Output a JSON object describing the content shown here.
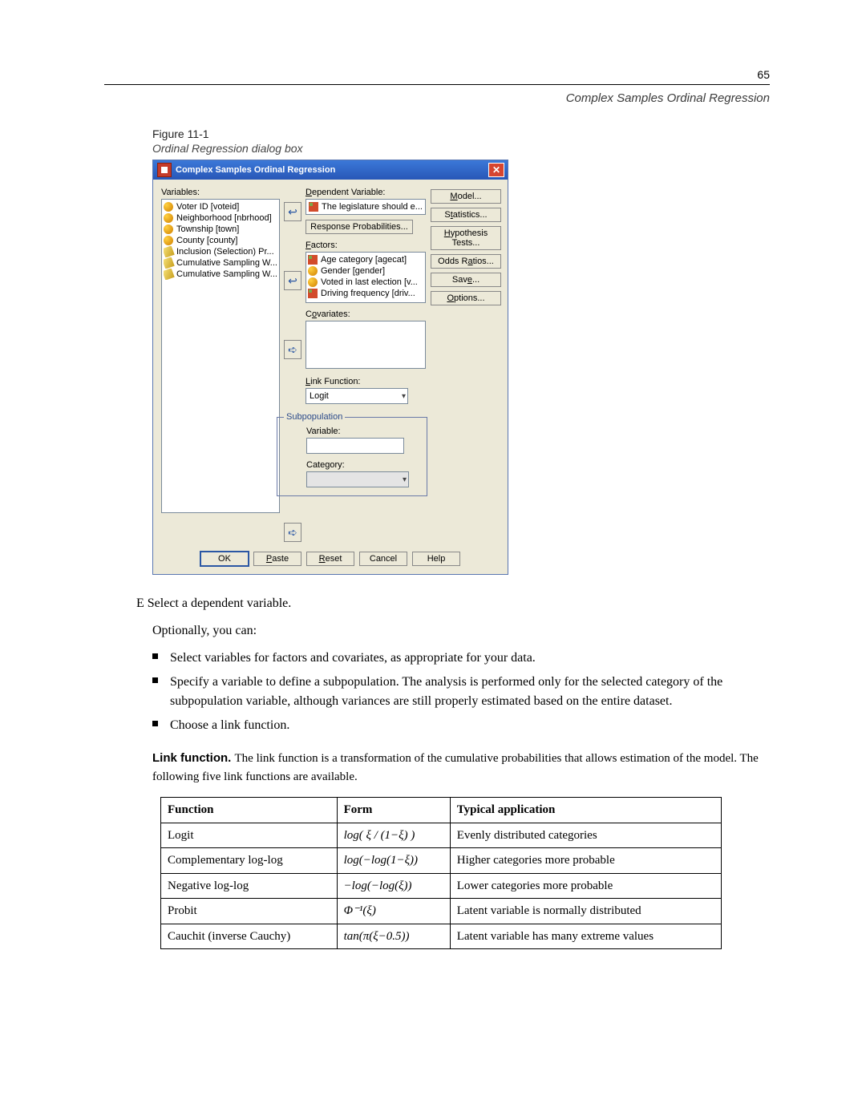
{
  "page": {
    "number": "65",
    "section": "Complex Samples Ordinal Regression"
  },
  "figure": {
    "label": "Figure 11-1",
    "caption": "Ordinal Regression dialog box"
  },
  "dialog": {
    "title": "Complex Samples Ordinal Regression",
    "variables_label": "Variables:",
    "variables": [
      {
        "icon": "scale",
        "text": "Voter ID [voteid]"
      },
      {
        "icon": "scale",
        "text": "Neighborhood [nbrhood]"
      },
      {
        "icon": "scale",
        "text": "Township [town]"
      },
      {
        "icon": "scale",
        "text": "County [county]"
      },
      {
        "icon": "ruler",
        "text": "Inclusion (Selection) Pr..."
      },
      {
        "icon": "ruler",
        "text": "Cumulative Sampling W..."
      },
      {
        "icon": "ruler",
        "text": "Cumulative Sampling W..."
      }
    ],
    "dependent_label": "Dependent Variable:",
    "dependent_value": "The legislature should e...",
    "response_btn": "Response Probabilities...",
    "factors_label": "Factors:",
    "factors": [
      {
        "icon": "ordinal",
        "text": "Age category [agecat]"
      },
      {
        "icon": "scale",
        "text": "Gender [gender]"
      },
      {
        "icon": "scale",
        "text": "Voted in last election [v..."
      },
      {
        "icon": "ordinal",
        "text": "Driving frequency [driv..."
      }
    ],
    "covariates_label": "Covariates:",
    "link_label": "Link Function:",
    "link_value": "Logit",
    "subpop_legend": "Subpopulation",
    "subpop_var_label": "Variable:",
    "subpop_cat_label": "Category:",
    "right_buttons": {
      "model": "Model...",
      "statistics": "Statistics...",
      "hyp": "Hypothesis Tests...",
      "odds": "Odds Ratios...",
      "save": "Save...",
      "options": "Options..."
    },
    "buttons": {
      "ok": "OK",
      "paste": "Paste",
      "reset": "Reset",
      "cancel": "Cancel",
      "help": "Help"
    }
  },
  "content": {
    "step": "E   Select a dependent variable.",
    "optionally": "Optionally, you can:",
    "bullets": [
      "Select variables for factors and covariates, as appropriate for your data.",
      "Specify a variable to define a subpopulation. The analysis is performed only for the selected category of the subpopulation variable, although variances are still properly estimated based on the entire dataset.",
      "Choose a link function."
    ],
    "link_heading": "Link function.",
    "link_para": " The link function is a transformation of the cumulative probabilities that allows estimation of the model. The following five link functions are available."
  },
  "table": {
    "headers": [
      "Function",
      "Form",
      "Typical application"
    ],
    "rows": [
      [
        "Logit",
        "log( ξ / (1−ξ) )",
        "Evenly distributed categories"
      ],
      [
        "Complementary log-log",
        "log(−log(1−ξ))",
        "Higher categories more probable"
      ],
      [
        "Negative log-log",
        "−log(−log(ξ))",
        "Lower categories more probable"
      ],
      [
        "Probit",
        "Φ⁻¹(ξ)",
        "Latent variable is normally distributed"
      ],
      [
        "Cauchit (inverse Cauchy)",
        "tan(π(ξ−0.5))",
        "Latent variable has many extreme values"
      ]
    ]
  }
}
